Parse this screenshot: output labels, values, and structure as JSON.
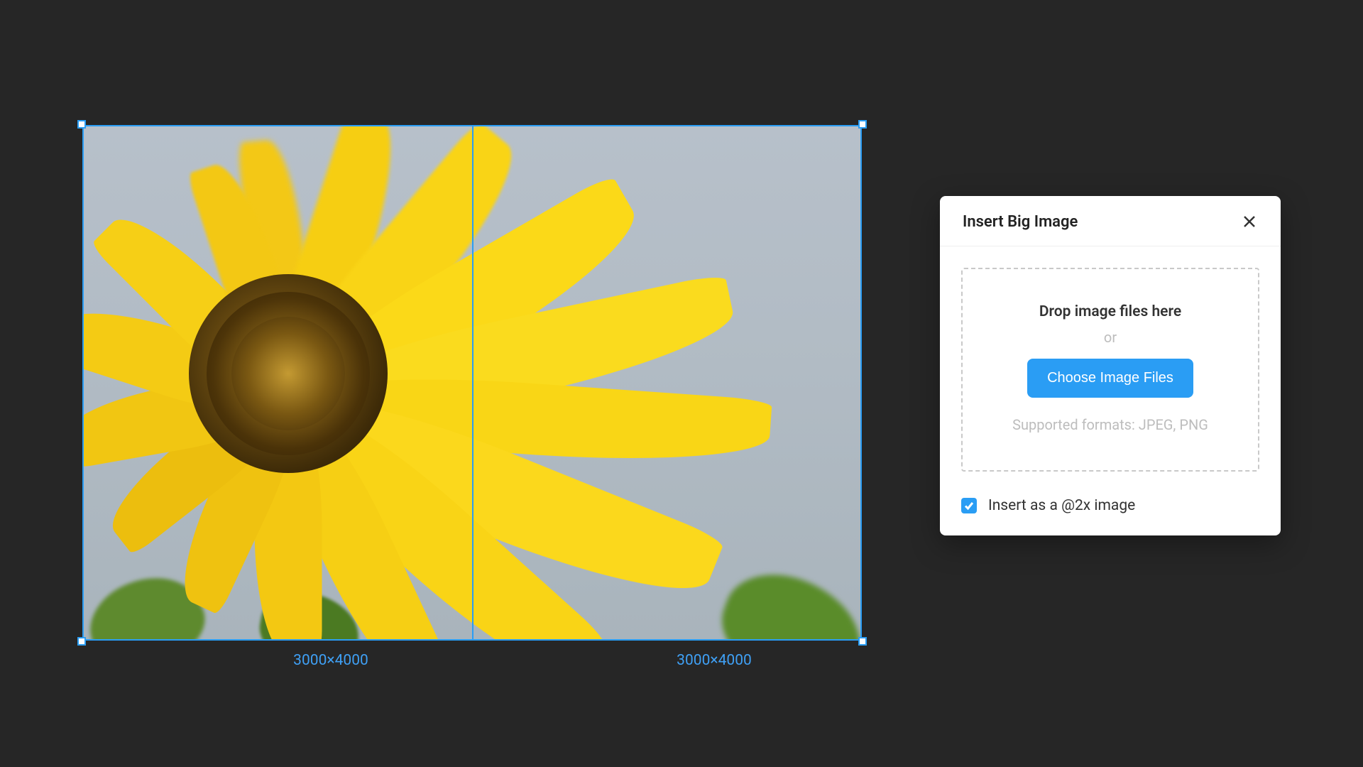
{
  "canvas": {
    "slices": [
      {
        "dimensions": "3000×4000"
      },
      {
        "dimensions": "3000×4000"
      }
    ],
    "selection_color": "#2a9df4"
  },
  "dialog": {
    "title": "Insert Big Image",
    "dropzone": {
      "headline": "Drop image files here",
      "or": "or",
      "button": "Choose Image Files",
      "supported": "Supported formats: JPEG, PNG"
    },
    "checkbox": {
      "label": "Insert as a @2x image",
      "checked": true
    }
  }
}
